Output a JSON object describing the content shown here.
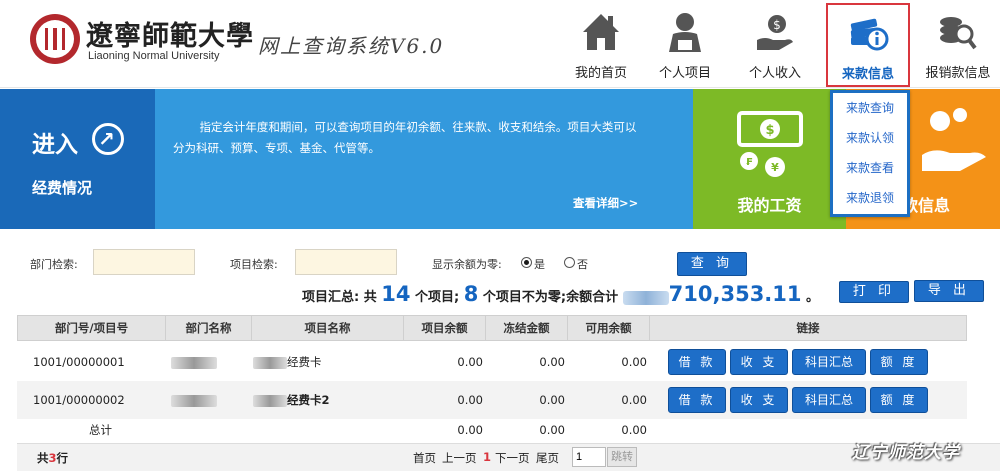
{
  "header": {
    "university_cn": "遼寧師範大學",
    "university_en": "Liaoning Normal University",
    "system_title": "网上查询系统V6.0",
    "nav": [
      {
        "label": "我的首页",
        "icon": "home-icon"
      },
      {
        "label": "个人项目",
        "icon": "person-icon"
      },
      {
        "label": "个人收入",
        "icon": "hand-money-icon"
      },
      {
        "label": "来款信息",
        "icon": "money-info-icon",
        "active": true
      },
      {
        "label": "报销款信息",
        "icon": "coins-search-icon"
      }
    ],
    "dropdown": [
      "来款查询",
      "来款认领",
      "来款查看",
      "来款退领"
    ]
  },
  "banners": {
    "enter_label": "进入",
    "fund_label": "经费情况",
    "description": "指定会计年度和期间，可以查询项目的年初余额、往来款、收支和结余。项目大类可以分为科研、预算、专项、基金、代管等。",
    "more_label": "查看详细>>",
    "salary_label": "我的工资",
    "orange_label": "款信息"
  },
  "filter": {
    "dept_label": "部门检索:",
    "dept_value": "",
    "project_label": "项目检索:",
    "project_value": "",
    "zero_label": "显示余额为零:",
    "yes_label": "是",
    "no_label": "否",
    "query_button": "查 询",
    "print_button": "打 印",
    "export_button": "导 出"
  },
  "summary": {
    "prefix": "项目汇总: 共",
    "total_count": "14",
    "mid1": "个项目;",
    "nonzero_count": "8",
    "mid2": "个项目不为零;余额合计",
    "amount": "710,353.11",
    "suffix": "。"
  },
  "table": {
    "headers": [
      "部门号/项目号",
      "部门名称",
      "项目名称",
      "项目余额",
      "冻结金额",
      "可用余额",
      "链接"
    ],
    "rows": [
      {
        "id": "1001/00000001",
        "dept": "",
        "project": "经费卡",
        "balance": "0.00",
        "frozen": "0.00",
        "available": "0.00"
      },
      {
        "id": "1001/00000002",
        "dept": "",
        "project": "经费卡2",
        "balance": "0.00",
        "frozen": "0.00",
        "available": "0.00"
      }
    ],
    "row_buttons": [
      "借 款",
      "收 支",
      "科目汇总",
      "额 度"
    ],
    "total_label": "总计",
    "total_balance": "0.00",
    "total_frozen": "0.00",
    "total_available": "0.00"
  },
  "footer": {
    "row_count_prefix": "共",
    "row_count": "3",
    "row_count_suffix": "行",
    "first": "首页",
    "prev": "上一页",
    "current": "1",
    "next": "下一页",
    "last": "尾页",
    "page_input": "1",
    "jump": "跳转"
  },
  "watermark": "辽宁师范大学",
  "colors": {
    "primary_blue": "#1a69b8",
    "light_blue": "#3399dd",
    "green": "#7dba26",
    "orange": "#f49217",
    "active_border": "#d9363e"
  }
}
